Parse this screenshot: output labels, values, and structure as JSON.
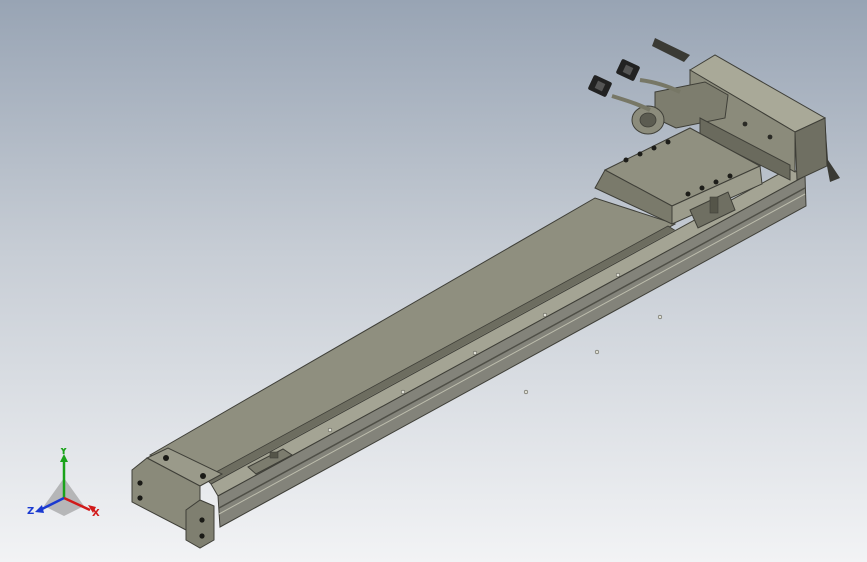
{
  "viewport": {
    "background_top": "#98a4b4",
    "background_bottom": "#f2f3f5"
  },
  "model": {
    "body_color": "#8f8f7f",
    "shadow_color": "#4d4d44",
    "highlight_color": "#b9b9aa"
  },
  "triad": {
    "x_label": "X",
    "y_label": "Y",
    "z_label": "Z",
    "x_color": "#d11a1a",
    "y_color": "#1aa31a",
    "z_color": "#1a3ad1"
  }
}
